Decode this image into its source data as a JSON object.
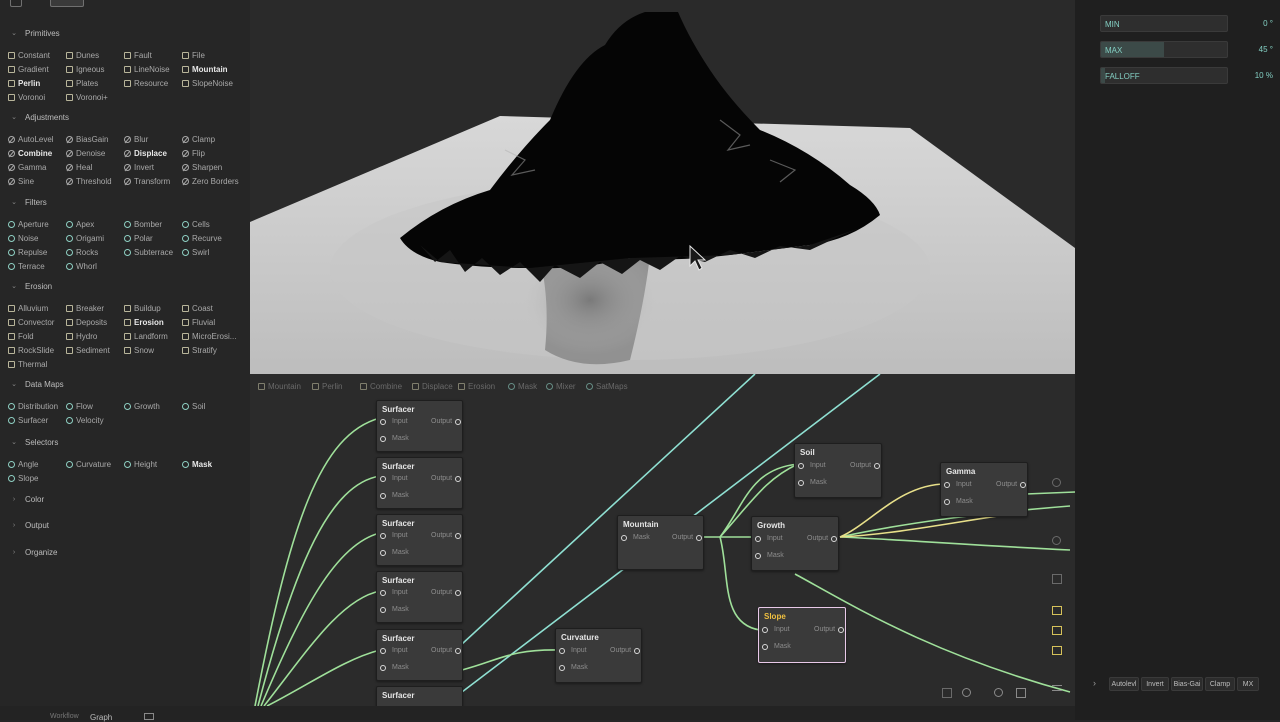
{
  "library": {
    "sections": {
      "primitives": "Primitives",
      "adjustments": "Adjustments",
      "filters": "Filters",
      "erosion": "Erosion",
      "data_maps": "Data Maps",
      "selectors": "Selectors",
      "color": "Color",
      "output": "Output",
      "organize": "Organize"
    },
    "primitives": [
      "Constant",
      "Dunes",
      "Fault",
      "File",
      "Gradient",
      "Igneous",
      "LineNoise",
      "Mountain",
      "Perlin",
      "Plates",
      "Resource",
      "SlopeNoise",
      "Voronoi",
      "Voronoi+"
    ],
    "adjustments": [
      "AutoLevel",
      "BiasGain",
      "Blur",
      "Clamp",
      "Combine",
      "Denoise",
      "Displace",
      "Flip",
      "Gamma",
      "Heal",
      "Invert",
      "Sharpen",
      "Sine",
      "Threshold",
      "Transform",
      "Zero Borders"
    ],
    "filters": [
      "Aperture",
      "Apex",
      "Bomber",
      "Cells",
      "Noise",
      "Origami",
      "Polar",
      "Recurve",
      "Repulse",
      "Rocks",
      "Subterrace",
      "Swirl",
      "Terrace",
      "Whorl"
    ],
    "erosion": [
      "Alluvium",
      "Breaker",
      "Buildup",
      "Coast",
      "Convector",
      "Deposits",
      "Erosion",
      "Fluvial",
      "Fold",
      "Hydro",
      "Landform",
      "MicroErosi...",
      "RockSlide",
      "Sediment",
      "Snow",
      "Stratify",
      "Thermal"
    ],
    "data_maps": [
      "Distribution",
      "Flow",
      "Growth",
      "Soil",
      "Surfacer",
      "Velocity"
    ],
    "selectors": [
      "Angle",
      "Curvature",
      "Height",
      "Mask",
      "Slope"
    ]
  },
  "graph": {
    "tabs": [
      "Mountain",
      "Perlin",
      "Combine",
      "Displace",
      "Erosion",
      "Mask",
      "Mixer",
      "SatMaps"
    ],
    "port_input": "Input",
    "port_output": "Output",
    "port_mask": "Mask",
    "nodes": {
      "surfacer": "Surfacer",
      "mountain": "Mountain",
      "curvature": "Curvature",
      "soil": "Soil",
      "growth": "Growth",
      "gamma": "Gamma",
      "slope": "Slope"
    }
  },
  "properties": {
    "min": {
      "label": "MIN",
      "value": "0",
      "unit": "°",
      "fill": 0.0
    },
    "max": {
      "label": "MAX",
      "value": "45",
      "unit": "°",
      "fill": 0.5
    },
    "falloff": {
      "label": "FALLOFF",
      "value": "10",
      "unit": "%",
      "fill": 0.03
    },
    "bottom_tabs": [
      "Autolevl",
      "Invert",
      "Bias-Gai",
      "Clamp",
      "MX"
    ]
  },
  "statusbar": {
    "left_label": "Workflow",
    "graph_label": "Graph"
  },
  "colors": {
    "wire_green": "#9fe09a",
    "wire_teal": "#8fe0d2",
    "wire_yellow": "#e8e08a",
    "selected_title": "#f0c040",
    "accent": "#84d0c4"
  }
}
